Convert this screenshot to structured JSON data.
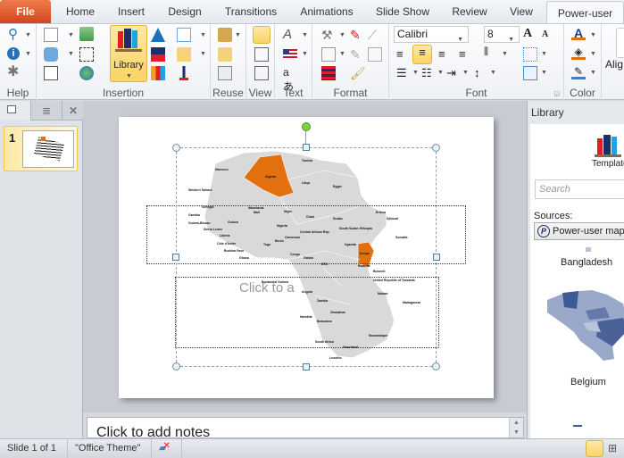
{
  "ribbon_tabs": [
    "File",
    "Home",
    "Insert",
    "Design",
    "Transitions",
    "Animations",
    "Slide Show",
    "Review",
    "View",
    "Power-user"
  ],
  "active_tab": "Power-user",
  "groups": {
    "help": "Help",
    "insertion": "Insertion",
    "reuse": "Reuse",
    "view": "View",
    "text": "Text",
    "format": "Format",
    "font": "Font",
    "color": "Color"
  },
  "library_button": "Library",
  "font": {
    "name": "Calibri",
    "size": "8"
  },
  "align_label": "Alig",
  "slides_pane": {
    "slide_number": "1"
  },
  "slide": {
    "placeholder": "Click to a",
    "highlighted_countries": [
      "Algeria",
      "Kenya"
    ],
    "highlight_color": "#e2700f",
    "map_labels": [
      "Morocco",
      "Western Sahara",
      "Algeria",
      "Tunisia",
      "Libya",
      "Egypt",
      "Mauritania",
      "Mali",
      "Niger",
      "Chad",
      "Sudan",
      "Eritrea",
      "Djibouti",
      "Senegal",
      "Gambia",
      "Guinea-Bissau",
      "Guinea",
      "Sierra Leone",
      "Liberia",
      "Côte d'Ivoire",
      "Burkina Faso",
      "Ghana",
      "Togo",
      "Benin",
      "Nigeria",
      "Cameroon",
      "Central African Rep.",
      "South Sudan",
      "Ethiopia",
      "Somalia",
      "Uganda",
      "Kenya",
      "Rwanda",
      "Burundi",
      "DRC",
      "Congo",
      "Gabon",
      "Equatorial Guinea",
      "United Republic of Tanzania",
      "Angola",
      "Zambia",
      "Malawi",
      "Mozambique",
      "Madagascar",
      "Zimbabwe",
      "Namibia",
      "Botswana",
      "South Africa",
      "Swaziland",
      "Lesotho"
    ]
  },
  "notes_placeholder": "Click to add notes",
  "library_pane": {
    "title": "Library",
    "templates_label": "Templates",
    "search_placeholder": "Search",
    "sources_label": "Sources:",
    "source_selected": "Power-user map",
    "items": [
      "Bangladesh",
      "Belgium"
    ]
  },
  "status": {
    "slide_info": "Slide 1 of 1",
    "theme": "\"Office Theme\""
  }
}
